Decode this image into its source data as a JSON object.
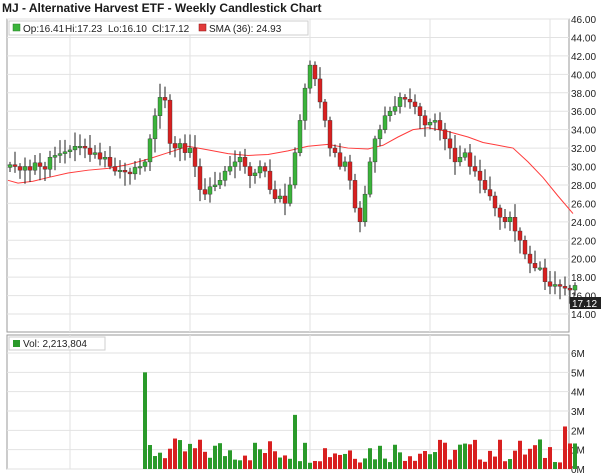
{
  "chart_data": [
    {
      "type": "candlestick",
      "title": "MJ - Alternative Harvest ETF - Weekly Candlestick Chart",
      "legend": {
        "ohlc": {
          "op": "Op:16.41",
          "hi": "Hi:17.23",
          "lo": "Lo:16.10",
          "cl": "Cl:17.12"
        },
        "sma": "SMA (36): 24.93"
      },
      "last_price_label": "17.12",
      "y_ticks": [
        "46.00",
        "44.00",
        "42.00",
        "40.00",
        "38.00",
        "36.00",
        "34.00",
        "32.00",
        "30.00",
        "28.00",
        "26.00",
        "24.00",
        "22.00",
        "20.00",
        "18.00",
        "16.00",
        "14.00"
      ],
      "ylim": [
        14,
        46
      ],
      "grid": true,
      "colors": {
        "up": "#3bb43b",
        "down": "#d92020",
        "sma": "#ff3b3b",
        "price_label_bg": "#222222"
      },
      "close_points": [
        [
          0,
          30.2
        ],
        [
          5,
          30.0
        ],
        [
          10,
          29.6
        ],
        [
          15,
          30.0
        ],
        [
          20,
          29.6
        ],
        [
          25,
          30.4
        ],
        [
          30,
          30.0
        ],
        [
          35,
          29.7
        ],
        [
          40,
          31.0
        ],
        [
          45,
          31.2
        ],
        [
          50,
          31.4
        ],
        [
          55,
          31.6
        ],
        [
          60,
          31.8
        ],
        [
          65,
          32.2
        ],
        [
          70,
          32.2
        ],
        [
          75,
          32.0
        ],
        [
          80,
          31.3
        ],
        [
          85,
          31.5
        ],
        [
          90,
          30.8
        ],
        [
          95,
          31.0
        ],
        [
          100,
          30.0
        ],
        [
          105,
          29.5
        ],
        [
          110,
          29.6
        ],
        [
          115,
          29.4
        ],
        [
          120,
          29.2
        ],
        [
          125,
          29.9
        ],
        [
          130,
          30.0
        ],
        [
          135,
          30.5
        ],
        [
          140,
          33.0
        ],
        [
          145,
          35.5
        ],
        [
          150,
          37.5
        ],
        [
          155,
          37.2
        ],
        [
          160,
          32.5
        ],
        [
          165,
          32.0
        ],
        [
          170,
          32.5
        ],
        [
          175,
          31.5
        ],
        [
          180,
          32.0
        ],
        [
          185,
          30.0
        ],
        [
          190,
          27.5
        ],
        [
          195,
          27.0
        ],
        [
          200,
          27.8
        ],
        [
          205,
          28.0
        ],
        [
          210,
          28.5
        ],
        [
          215,
          29.5
        ],
        [
          220,
          30.0
        ],
        [
          225,
          30.5
        ],
        [
          230,
          31.0
        ],
        [
          235,
          30.0
        ],
        [
          240,
          29.0
        ],
        [
          245,
          29.3
        ],
        [
          250,
          30.0
        ],
        [
          255,
          29.5
        ],
        [
          260,
          27.5
        ],
        [
          265,
          26.5
        ],
        [
          270,
          26.8
        ],
        [
          275,
          26.0
        ],
        [
          280,
          28.0
        ],
        [
          285,
          31.5
        ],
        [
          290,
          35.0
        ],
        [
          295,
          38.5
        ],
        [
          300,
          41.0
        ],
        [
          305,
          39.5
        ],
        [
          310,
          37.0
        ],
        [
          315,
          35.0
        ],
        [
          320,
          32.0
        ],
        [
          325,
          31.5
        ],
        [
          330,
          30.0
        ],
        [
          335,
          30.5
        ],
        [
          340,
          28.5
        ],
        [
          345,
          25.5
        ],
        [
          350,
          24.0
        ],
        [
          355,
          27.0
        ],
        [
          360,
          30.5
        ],
        [
          365,
          33.0
        ],
        [
          370,
          34.0
        ],
        [
          375,
          35.5
        ],
        [
          380,
          36.0
        ],
        [
          385,
          36.5
        ],
        [
          390,
          37.5
        ],
        [
          395,
          37.3
        ],
        [
          400,
          37.0
        ],
        [
          405,
          36.5
        ],
        [
          410,
          35.5
        ],
        [
          415,
          34.5
        ],
        [
          420,
          34.8
        ],
        [
          425,
          35.0
        ],
        [
          430,
          34.0
        ],
        [
          435,
          33.0
        ],
        [
          440,
          32.0
        ],
        [
          445,
          30.5
        ],
        [
          450,
          31.0
        ],
        [
          455,
          31.5
        ],
        [
          460,
          30.0
        ],
        [
          465,
          29.5
        ],
        [
          470,
          28.5
        ],
        [
          475,
          27.5
        ],
        [
          480,
          26.8
        ],
        [
          485,
          25.5
        ],
        [
          490,
          24.5
        ],
        [
          495,
          24.0
        ],
        [
          500,
          24.5
        ],
        [
          505,
          23.0
        ],
        [
          510,
          22.0
        ],
        [
          515,
          20.5
        ],
        [
          520,
          19.5
        ],
        [
          525,
          19.0
        ],
        [
          530,
          19.0
        ],
        [
          535,
          17.5
        ],
        [
          540,
          17.0
        ],
        [
          545,
          17.2
        ],
        [
          550,
          17.0
        ],
        [
          555,
          16.8
        ],
        [
          560,
          16.6
        ],
        [
          565,
          17.1
        ]
      ],
      "sma_points": [
        [
          0,
          28.5
        ],
        [
          10,
          28.2
        ],
        [
          25,
          28.4
        ],
        [
          40,
          28.8
        ],
        [
          60,
          29.3
        ],
        [
          80,
          29.6
        ],
        [
          100,
          29.8
        ],
        [
          120,
          30.2
        ],
        [
          140,
          30.8
        ],
        [
          160,
          31.5
        ],
        [
          180,
          32.2
        ],
        [
          200,
          31.8
        ],
        [
          220,
          31.4
        ],
        [
          240,
          31.2
        ],
        [
          260,
          31.3
        ],
        [
          280,
          31.7
        ],
        [
          300,
          32.2
        ],
        [
          320,
          32.4
        ],
        [
          340,
          32.0
        ],
        [
          360,
          31.9
        ],
        [
          375,
          32.3
        ],
        [
          390,
          33.2
        ],
        [
          405,
          34.0
        ],
        [
          420,
          34.2
        ],
        [
          440,
          33.8
        ],
        [
          460,
          33.2
        ],
        [
          475,
          32.6
        ],
        [
          490,
          32.3
        ],
        [
          505,
          32.0
        ],
        [
          520,
          30.5
        ],
        [
          535,
          28.8
        ],
        [
          550,
          26.8
        ],
        [
          565,
          24.9
        ]
      ]
    },
    {
      "type": "bar",
      "title": "Vol: 2,213,804",
      "y_ticks": [
        "6M",
        "5M",
        "4M",
        "3M",
        "2M",
        "1M",
        "0M"
      ],
      "ylim": [
        0,
        6
      ],
      "colors": {
        "up": "#2a9a2a",
        "down": "#d82020"
      }
    }
  ]
}
